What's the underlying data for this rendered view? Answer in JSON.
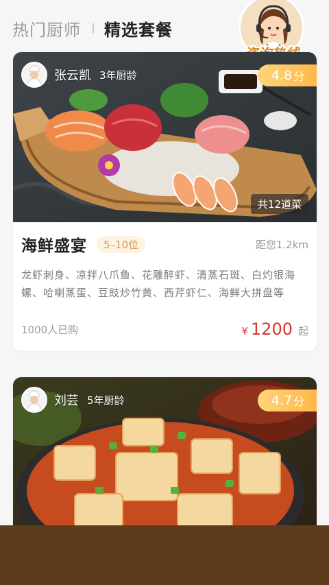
{
  "tabs": {
    "inactive": "热门厨师",
    "active": "精选套餐"
  },
  "hotline": {
    "label": "咨询热线"
  },
  "cards": [
    {
      "chef_name": "张云凯",
      "chef_years": "3年厨龄",
      "rating": "4.8",
      "rating_unit": "分",
      "dish_count": "共12道菜",
      "dish_name": "海鲜盛宴",
      "seats": "5–10位",
      "distance": "距您1.2km",
      "menu": "龙虾刺身、凉拌八爪鱼、花雕醉虾、清蒸石斑、白灼银海螺、哈喇蒸蛋、豆豉炒竹黄、西芹虾仁、海鲜大拼盘等",
      "bought": "1000人已购",
      "currency": "¥",
      "price": "1200",
      "price_suffix": "起"
    },
    {
      "chef_name": "刘芸",
      "chef_years": "5年厨龄",
      "rating": "4.7",
      "rating_unit": "分"
    }
  ],
  "colors": {
    "accent_price": "#d8372c",
    "rating_badge": "#ffb74a",
    "bottom_panel": "#5d3c1d"
  }
}
